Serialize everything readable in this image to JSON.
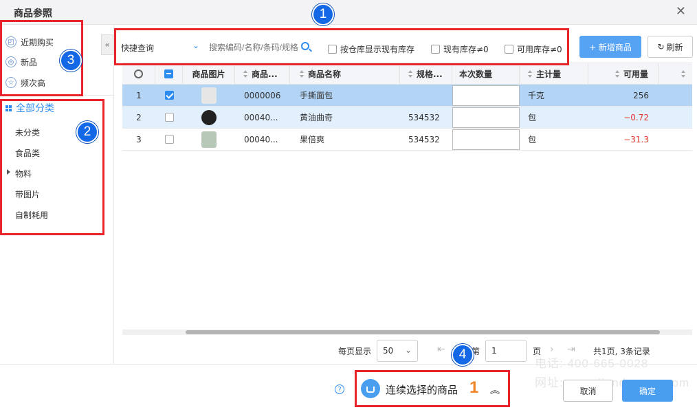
{
  "dialog": {
    "title": "商品参照",
    "close_icon": "close-icon"
  },
  "left": {
    "quick_filters": [
      {
        "label": "近期购买",
        "icon": "shopping-bag-icon"
      },
      {
        "label": "新品",
        "icon": "new-badge-icon"
      },
      {
        "label": "频次高",
        "icon": "star-icon"
      }
    ],
    "category_root": "全部分类",
    "categories": [
      "未分类",
      "食品类",
      "物料",
      "带图片",
      "自制耗用"
    ]
  },
  "toolbar": {
    "quick_query": "快捷查询",
    "search_placeholder": "搜索编码/名称/条码/规格",
    "check_by_warehouse": "按仓库显示现有库存",
    "check_stock_nonzero": "现有库存≠0",
    "check_available_nonzero": "可用库存≠0",
    "add_button": "+ 新增商品",
    "refresh_button": "刷新",
    "refresh_icon": "↻"
  },
  "table": {
    "headers": {
      "image": "商品图片",
      "code": "商品...",
      "name": "商品名称",
      "spec": "规格...",
      "qty": "本次数量",
      "unit": "主计量",
      "available": "可用量"
    },
    "rows": [
      {
        "index": "1",
        "checked": true,
        "code": "0000006",
        "name": "手撕面包",
        "spec": "",
        "unit": "千克",
        "available": "256",
        "negative": false,
        "thumb_color": "#d9d9d9"
      },
      {
        "index": "2",
        "checked": false,
        "code": "00040...",
        "name": "黄油曲奇",
        "spec": "534532",
        "unit": "包",
        "available": "−0.72",
        "negative": true,
        "thumb_color": "#222222"
      },
      {
        "index": "3",
        "checked": false,
        "code": "00040...",
        "name": "果倍爽",
        "spec": "534532",
        "unit": "包",
        "available": "−31.3",
        "negative": true,
        "thumb_color": "#9fb7a0"
      }
    ]
  },
  "pagination": {
    "page_size_label": "每页显示",
    "page_size": "50",
    "page_prefix": "第",
    "page_number": "1",
    "page_suffix": "页",
    "summary": "共1页, 3条记录"
  },
  "footer": {
    "cart_label": "连续选择的商品",
    "cart_count": "1",
    "cancel": "取消",
    "confirm": "确定"
  },
  "annotations": [
    "1",
    "2",
    "3",
    "4"
  ],
  "watermark": {
    "line1": "电话: 400-665-0028",
    "line2": "网址: www.jiandaoyun.com"
  },
  "colors": {
    "accent": "#2d8cf0",
    "highlight": "#e8242a",
    "selected_row": "#b3d4f5",
    "negative": "#e8342e",
    "badge": "#1468e6"
  }
}
